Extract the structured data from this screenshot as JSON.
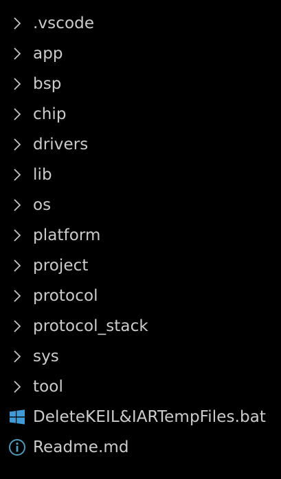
{
  "explorer": {
    "items": [
      {
        "label": ".vscode",
        "kind": "folder",
        "icon": "chevron-right-icon"
      },
      {
        "label": "app",
        "kind": "folder",
        "icon": "chevron-right-icon"
      },
      {
        "label": "bsp",
        "kind": "folder",
        "icon": "chevron-right-icon"
      },
      {
        "label": "chip",
        "kind": "folder",
        "icon": "chevron-right-icon"
      },
      {
        "label": "drivers",
        "kind": "folder",
        "icon": "chevron-right-icon"
      },
      {
        "label": "lib",
        "kind": "folder",
        "icon": "chevron-right-icon"
      },
      {
        "label": "os",
        "kind": "folder",
        "icon": "chevron-right-icon"
      },
      {
        "label": "platform",
        "kind": "folder",
        "icon": "chevron-right-icon"
      },
      {
        "label": "project",
        "kind": "folder",
        "icon": "chevron-right-icon"
      },
      {
        "label": "protocol",
        "kind": "folder",
        "icon": "chevron-right-icon"
      },
      {
        "label": "protocol_stack",
        "kind": "folder",
        "icon": "chevron-right-icon"
      },
      {
        "label": "sys",
        "kind": "folder",
        "icon": "chevron-right-icon"
      },
      {
        "label": "tool",
        "kind": "folder",
        "icon": "chevron-right-icon"
      },
      {
        "label": "DeleteKEIL&IARTempFiles.bat",
        "kind": "file",
        "icon": "windows-icon"
      },
      {
        "label": "Readme.md",
        "kind": "file",
        "icon": "info-icon"
      }
    ]
  },
  "colors": {
    "background": "#000000",
    "text": "#cccccc",
    "chevron": "#c5c5c5",
    "windows_icon": "#3f9ad6",
    "info_icon": "#519aba"
  }
}
